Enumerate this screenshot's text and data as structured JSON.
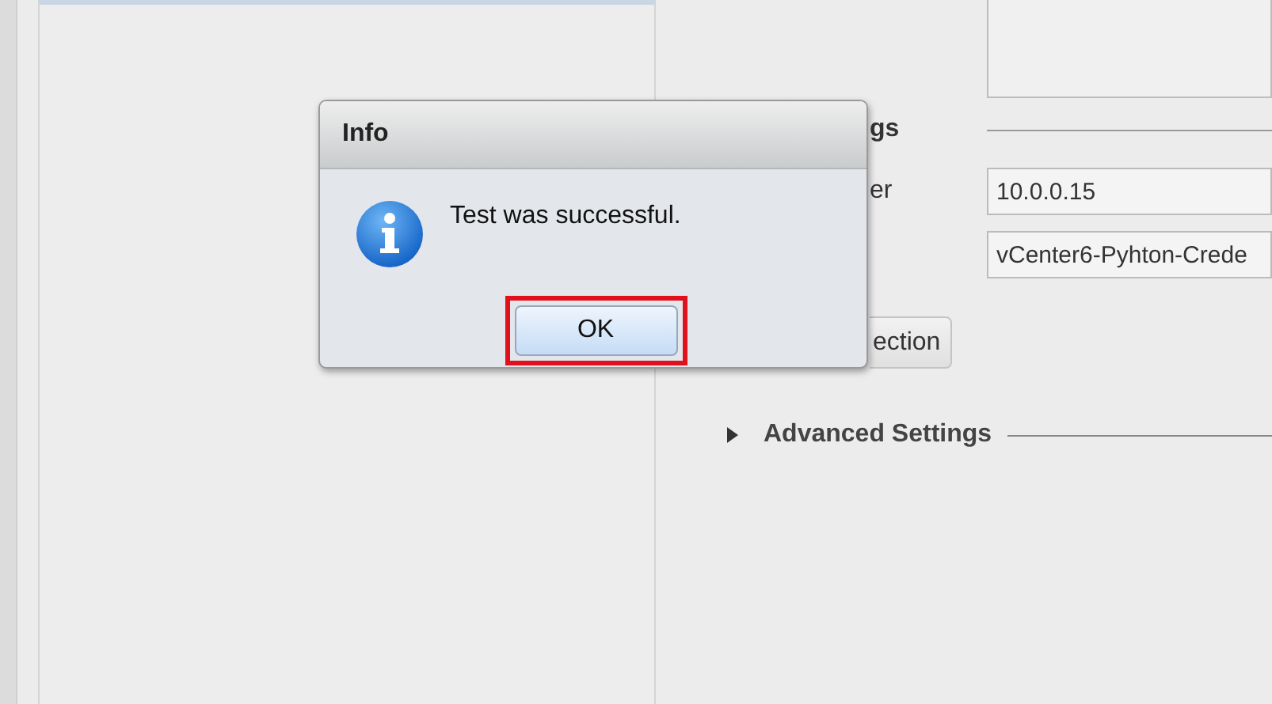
{
  "dialog": {
    "title": "Info",
    "message": "Test was successful.",
    "button": "OK",
    "button_highlighted": true
  },
  "background": {
    "section_heading": "gs",
    "field_label": "er",
    "fields": [
      {
        "value": "10.0.0.15"
      },
      {
        "value": "vCenter6-Pyhton-Crede"
      }
    ],
    "button": "ection",
    "advanced_settings": {
      "label": "Advanced Settings",
      "expanded": false
    }
  }
}
